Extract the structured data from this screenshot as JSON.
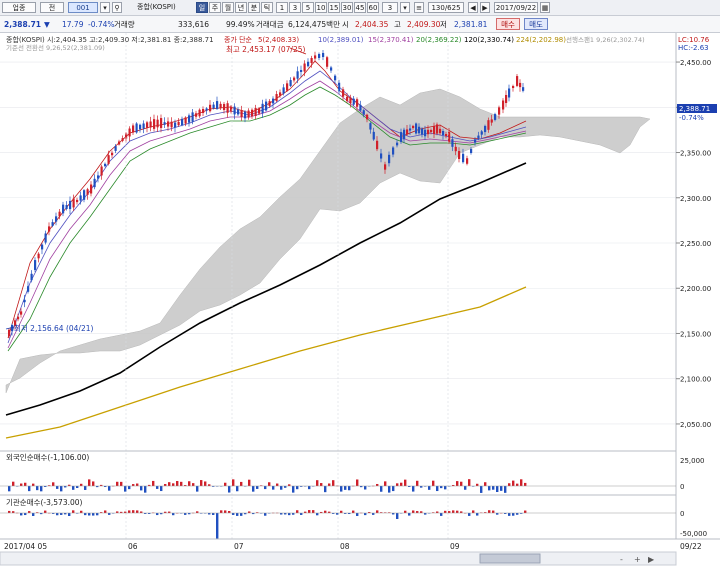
{
  "toolbar": {
    "market_combo": "업종",
    "period_combo": "전",
    "code_input": "001",
    "index_name": "종합(KOSPI)",
    "index_name_short": "종합(KOSPI)",
    "periods": [
      "일",
      "주",
      "월",
      "년",
      "분",
      "틱"
    ],
    "minute_steps": [
      "1",
      "3",
      "5",
      "10",
      "15",
      "30",
      "45",
      "60",
      "3"
    ],
    "count_display": "130/625",
    "date_input": "2017/09/22"
  },
  "infobar": {
    "price": "2,388.71",
    "change_arrow": "▼",
    "change": "17.79",
    "change_pct": "-0.74%",
    "volume_label": "거래량",
    "volume": "333,616",
    "volume_ratio": "99.49%",
    "amount_label": "거래대금",
    "amount": "6,124,475백만",
    "open_label": "시",
    "open": "2,404.35",
    "high_label": "고",
    "high": "2,409.30",
    "low_label": "저",
    "low": "2,381.81",
    "buy_button": "매수",
    "sell_button": "매도"
  },
  "legend": {
    "ohlc_text": "종합(KOSPI) 시:2,404.35 고:2,409.30 저:2,381.81 종:2,388.71",
    "ma_prefix": "종가 단순",
    "ma5": "5(2,408.33)",
    "ma10": "10(2,389.01)",
    "ma15": "15(2,370.41)",
    "ma20": "20(2,369.22)",
    "ma120": "120(2,330.74)",
    "ma224": "224(2,202.98)",
    "ichimoku_span": "선행스팬1 9,26(2,302.74)",
    "ichimoku_base": "기준선 전환선 9,26,52(2,381.09)",
    "lc": "LC:10.76",
    "hc": "HC:-2.63"
  },
  "annotations": {
    "high": "최고 2,453.17 (07/25)",
    "low": "최저 2,156.64 (04/21)"
  },
  "price_badge": {
    "price": "2,388.71",
    "pct": "-0.74%"
  },
  "price_axis": [
    "2,450.00",
    "2,400.00",
    "2,350.00",
    "2,300.00",
    "2,250.00",
    "2,200.00",
    "2,150.00",
    "2,100.00",
    "2,050.00"
  ],
  "foreign_panel": {
    "title": "외국인순매수(-1,106.00)",
    "axis": [
      "25,000",
      "0"
    ]
  },
  "inst_panel": {
    "title": "기관순매수(-3,573.00)",
    "axis": [
      "0",
      "-50,000"
    ]
  },
  "time_axis": [
    "2017/04 05",
    "06",
    "07",
    "08",
    "09",
    "09/22"
  ],
  "colors": {
    "up": "#d0202a",
    "down": "#2050c0",
    "cloud": "#c9c9c9",
    "ma120": "#000000",
    "ma224": "#c8a000"
  }
}
